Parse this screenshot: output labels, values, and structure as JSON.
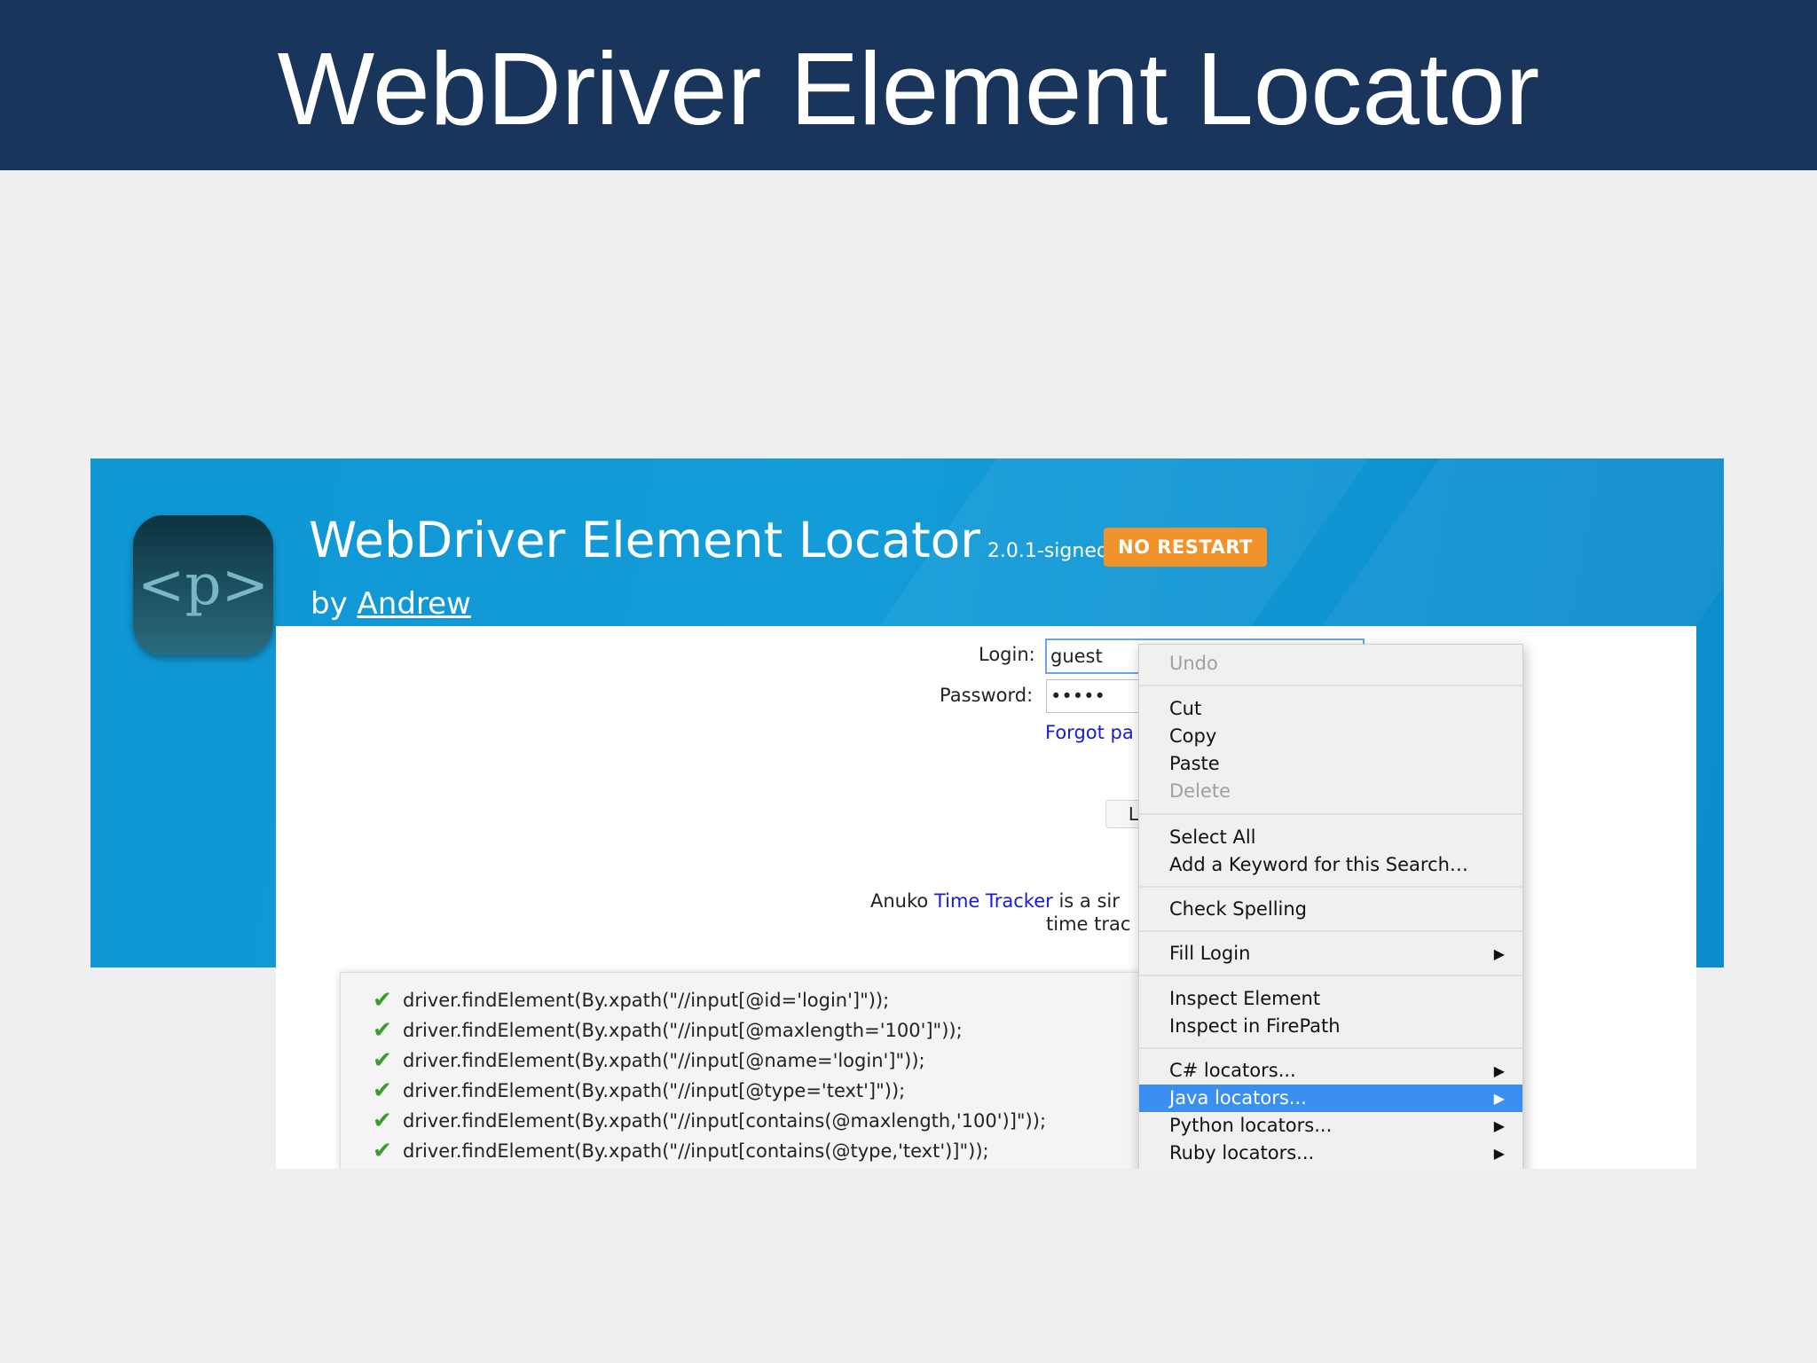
{
  "slide": {
    "title": "WebDriver Element Locator"
  },
  "banner": {
    "icon_text": "<p>",
    "extension_name": "WebDriver Element Locator",
    "version": "2.0.1-signed",
    "badge": "NO RESTART",
    "by_prefix": "by",
    "author": "Andrew"
  },
  "login_form": {
    "login_label": "Login:",
    "login_value": "guest",
    "password_label": "Password:",
    "password_value": "•••••",
    "forgot_link": "Forgot pa",
    "button_stub": "L",
    "footer_prefix": "Anuko",
    "footer_link": "Time Tracker",
    "footer_suffix": "is a sir",
    "footer_line2": "time trac"
  },
  "locators": [
    "driver.findElement(By.xpath(\"//input[@id='login']\"));",
    "driver.findElement(By.xpath(\"//input[@maxlength='100']\"));",
    "driver.findElement(By.xpath(\"//input[@name='login']\"));",
    "driver.findElement(By.xpath(\"//input[@type='text']\"));",
    "driver.findElement(By.xpath(\"//input[contains(@maxlength,'100')]\"));",
    "driver.findElement(By.xpath(\"//input[contains(@type,'text')]\"));"
  ],
  "context_menu": {
    "undo": "Undo",
    "cut": "Cut",
    "copy": "Copy",
    "paste": "Paste",
    "delete": "Delete",
    "select_all": "Select All",
    "add_keyword": "Add a Keyword for this Search…",
    "check_spelling": "Check Spelling",
    "fill_login": "Fill Login",
    "inspect_element": "Inspect Element",
    "inspect_firepath": "Inspect in FirePath",
    "csharp": "C# locators...",
    "java": "Java locators...",
    "python": "Python locators...",
    "ruby": "Ruby locators..."
  },
  "colors": {
    "title_bar": "#1a355c",
    "banner_blue": "#139cd8",
    "badge_orange": "#f0932a",
    "menu_highlight": "#3b8ff0",
    "check_green": "#3b9b2c"
  }
}
